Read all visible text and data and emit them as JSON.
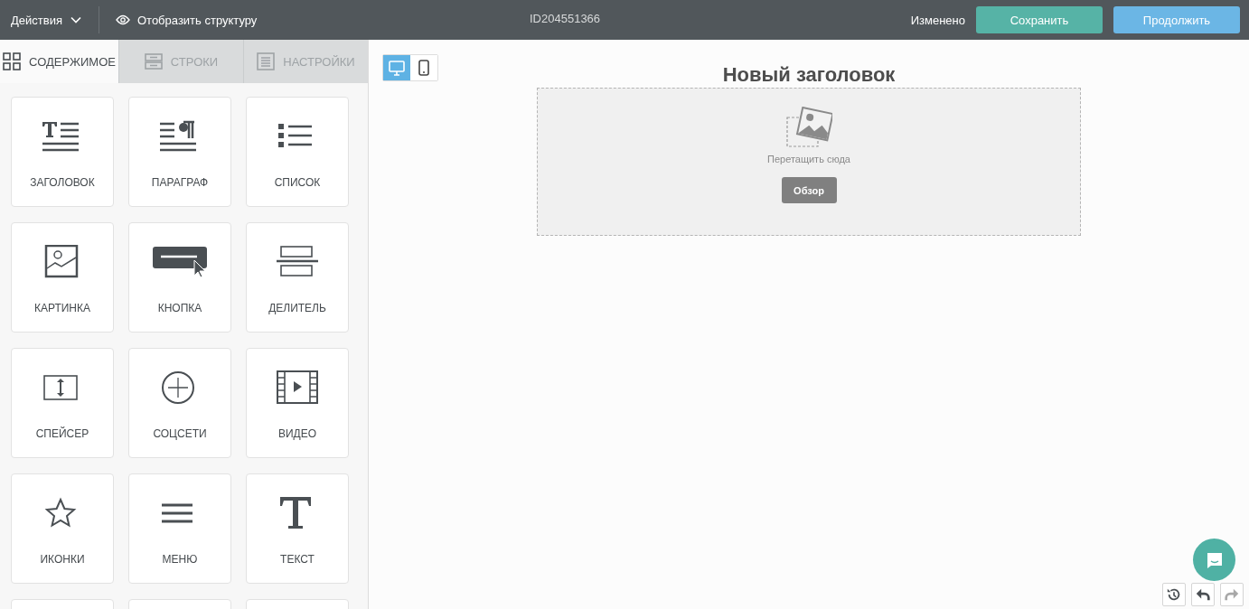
{
  "topbar": {
    "actions_menu": "Действия",
    "structure_toggle": "Отобразить структуру",
    "document_id": "ID204551366",
    "save_status": "Изменено",
    "buttons": [
      {
        "label": "Сохранить",
        "kind": "save"
      },
      {
        "label": "Продолжить",
        "kind": "continue"
      }
    ]
  },
  "sidebar": {
    "tabs": [
      {
        "label": "СОДЕРЖИМОЕ",
        "kind": "content",
        "selected": true
      },
      {
        "label": "СТРОКИ",
        "kind": "rows",
        "selected": false
      },
      {
        "label": "НАСТРОЙКИ",
        "kind": "settings",
        "selected": false
      }
    ],
    "blocks": [
      {
        "label": "ЗАГОЛОВОК",
        "kind": "heading"
      },
      {
        "label": "ПАРАГРАФ",
        "kind": "paragraph"
      },
      {
        "label": "СПИСОК",
        "kind": "list"
      },
      {
        "label": "КАРТИНКА",
        "kind": "image"
      },
      {
        "label": "КНОПКА",
        "kind": "button"
      },
      {
        "label": "ДЕЛИТЕЛЬ",
        "kind": "divider"
      },
      {
        "label": "СПЕЙСЕР",
        "kind": "spacer"
      },
      {
        "label": "СОЦСЕТИ",
        "kind": "social"
      },
      {
        "label": "ВИДЕО",
        "kind": "video"
      },
      {
        "label": "ИКОНКИ",
        "kind": "icons"
      },
      {
        "label": "МЕНЮ",
        "kind": "menu"
      },
      {
        "label": "ТЕКСТ",
        "kind": "text"
      }
    ]
  },
  "canvas": {
    "devices": [
      {
        "kind": "desktop",
        "selected": true
      },
      {
        "kind": "mobile",
        "selected": false
      }
    ],
    "heading": "Новый заголовок",
    "dropzone": {
      "hint": "Перетащить сюда",
      "button": "Обзор"
    },
    "history_controls": [
      {
        "kind": "history",
        "disabled": false
      },
      {
        "kind": "undo",
        "disabled": false
      },
      {
        "kind": "redo",
        "disabled": true
      }
    ]
  }
}
